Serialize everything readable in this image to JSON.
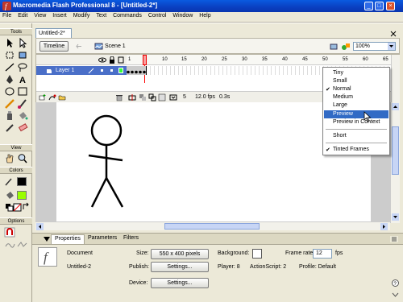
{
  "window": {
    "title": "Macromedia Flash Professional 8 - [Untitled-2*]",
    "minimize": "_",
    "maximize": "□",
    "close": "×"
  },
  "menubar": {
    "items": [
      "File",
      "Edit",
      "View",
      "Insert",
      "Modify",
      "Text",
      "Commands",
      "Control",
      "Window",
      "Help"
    ]
  },
  "tools": {
    "section_tools": "Tools",
    "section_view": "View",
    "section_colors": "Colors",
    "section_options": "Options"
  },
  "document": {
    "tab": "Untitled-2*",
    "timeline_button": "Timeline",
    "scene": "Scene 1",
    "zoom": "100%"
  },
  "timeline": {
    "layer_name": "Layer 1",
    "frame_numbers": [
      "1",
      "5",
      "10",
      "15",
      "20",
      "25",
      "30",
      "35",
      "40",
      "45",
      "50",
      "55",
      "60",
      "65"
    ],
    "current_frame": "5",
    "frame_rate": "12.0 fps",
    "elapsed": "0.3s"
  },
  "dropdown": {
    "items": [
      "Tiny",
      "Small",
      "Normal",
      "Medium",
      "Large",
      "Preview",
      "Preview in Context",
      "Short",
      "Tinted Frames"
    ],
    "checked": "✔"
  },
  "properties": {
    "tabs": [
      "Properties",
      "Parameters",
      "Filters"
    ],
    "doc_type": "Document",
    "doc_name": "Untitled-2",
    "size_label": "Size:",
    "size_value": "550 x 400 pixels",
    "background_label": "Background:",
    "frame_rate_label": "Frame rate:",
    "frame_rate_value": "12",
    "fps_unit": "fps",
    "publish_label": "Publish:",
    "settings_button": "Settings...",
    "player_text": "Player: 8",
    "actionscript_text": "ActionScript: 2",
    "profile_text": "Profile: Default",
    "device_label": "Device:",
    "device_button": "Settings..."
  },
  "colors": {
    "titlebar": "#0a4fd6",
    "chrome": "#ece9d8",
    "selection": "#316ac5",
    "playhead": "#ff0000",
    "fill_swatch": "#99ff00"
  }
}
